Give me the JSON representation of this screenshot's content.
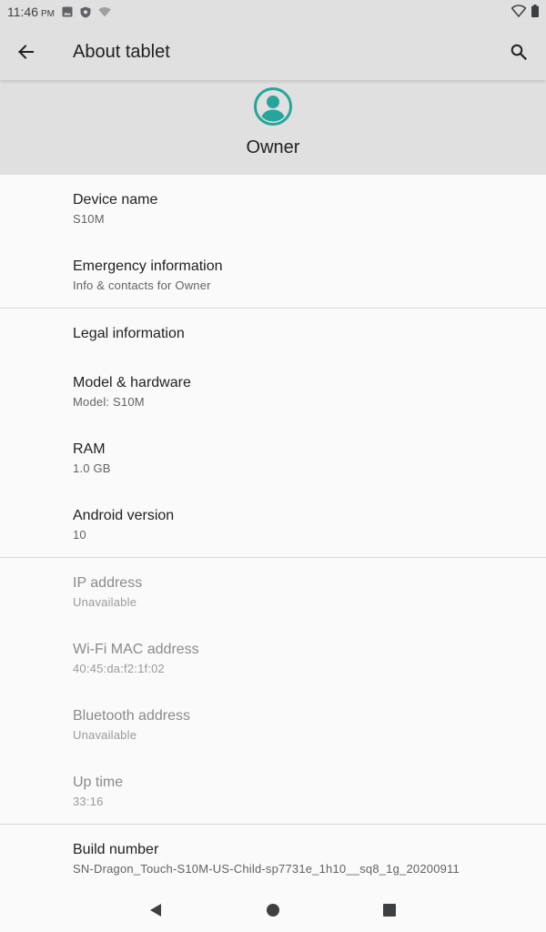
{
  "status_bar": {
    "time": "11:46",
    "ampm": "PM",
    "icons_left": [
      "image-icon",
      "shield-icon",
      "wifi-off-icon"
    ],
    "icons_right": [
      "wifi-icon",
      "battery-icon"
    ]
  },
  "app_bar": {
    "title": "About tablet",
    "back_icon": "arrow-back-icon",
    "search_icon": "search-icon"
  },
  "profile": {
    "name": "Owner",
    "avatar_color": "#26a69a"
  },
  "groups": [
    {
      "items": [
        {
          "title": "Device name",
          "subtitle": "S10M"
        },
        {
          "title": "Emergency information",
          "subtitle": "Info & contacts for Owner"
        }
      ]
    },
    {
      "items": [
        {
          "title": "Legal information",
          "subtitle": ""
        },
        {
          "title": "Model & hardware",
          "subtitle": "Model: S10M"
        },
        {
          "title": "RAM",
          "subtitle": "1.0 GB"
        },
        {
          "title": "Android version",
          "subtitle": "10"
        }
      ]
    },
    {
      "items": [
        {
          "title": "IP address",
          "subtitle": "Unavailable"
        },
        {
          "title": "Wi-Fi MAC address",
          "subtitle": "40:45:da:f2:1f:02"
        },
        {
          "title": "Bluetooth address",
          "subtitle": "Unavailable"
        },
        {
          "title": "Up time",
          "subtitle": "33:16"
        }
      ]
    },
    {
      "items": [
        {
          "title": "Build number",
          "subtitle": "SN-Dragon_Touch-S10M-US-Child-sp7731e_1h10__sq8_1g_20200911"
        }
      ]
    }
  ],
  "nav_bar": {
    "buttons": [
      "back-triangle-icon",
      "home-circle-icon",
      "recents-square-icon"
    ]
  }
}
